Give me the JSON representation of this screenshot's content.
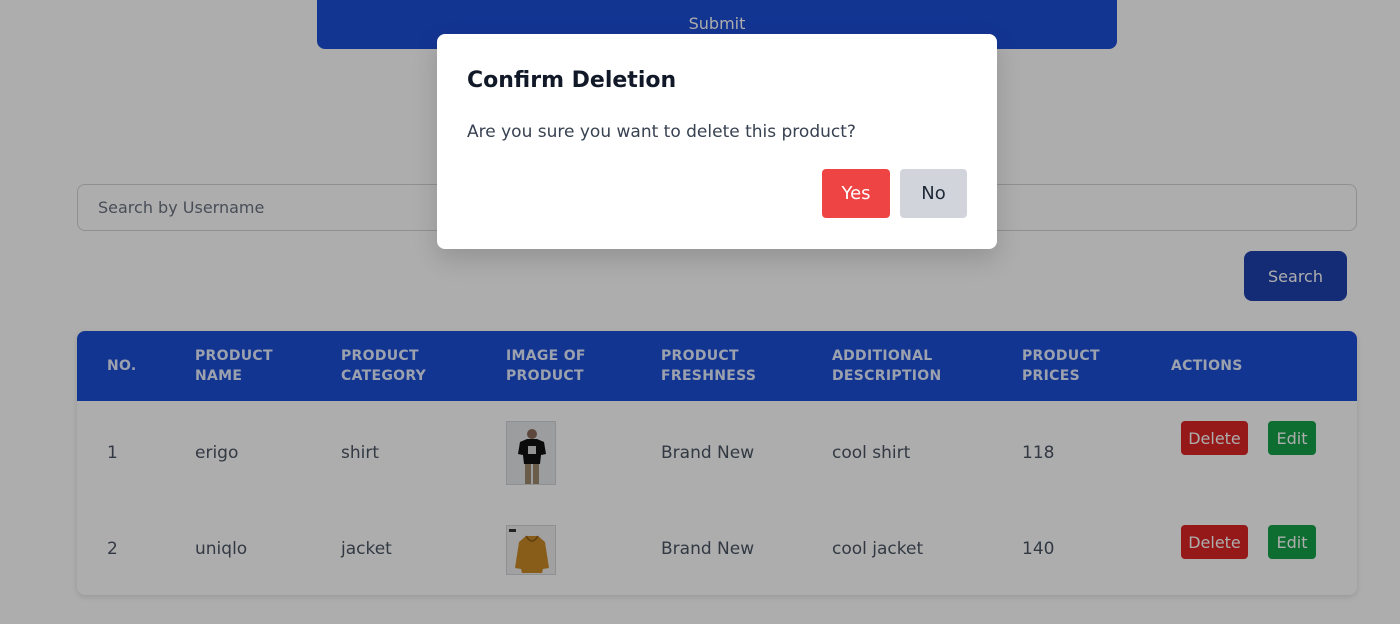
{
  "form": {
    "submit_label": "Submit"
  },
  "search": {
    "placeholder": "Search by Username",
    "button_label": "Search"
  },
  "table": {
    "headers": [
      "NO.",
      "PRODUCT\nNAME",
      "PRODUCT\nCATEGORY",
      "IMAGE OF\nPRODUCT",
      "PRODUCT\nFRESHNESS",
      "ADDITIONAL\nDESCRIPTION",
      "PRODUCT\nPRICES",
      "ACTIONS"
    ],
    "rows": [
      {
        "no": "1",
        "name": "erigo",
        "category": "shirt",
        "image": "black t-shirt photo",
        "freshness": "Brand New",
        "description": "cool shirt",
        "price": "118",
        "delete_label": "Delete",
        "edit_label": "Edit"
      },
      {
        "no": "2",
        "name": "uniqlo",
        "category": "jacket",
        "image": "mustard hoodie photo",
        "freshness": "Brand New",
        "description": "cool jacket",
        "price": "140",
        "delete_label": "Delete",
        "edit_label": "Edit"
      }
    ]
  },
  "modal": {
    "title": "Confirm Deletion",
    "message": "Are you sure you want to delete this product?",
    "yes_label": "Yes",
    "no_label": "No"
  },
  "colors": {
    "primary": "#1d4ed8",
    "danger": "#dc2626",
    "success": "#16a34a",
    "overlay": "rgba(0,0,0,0.32)"
  }
}
